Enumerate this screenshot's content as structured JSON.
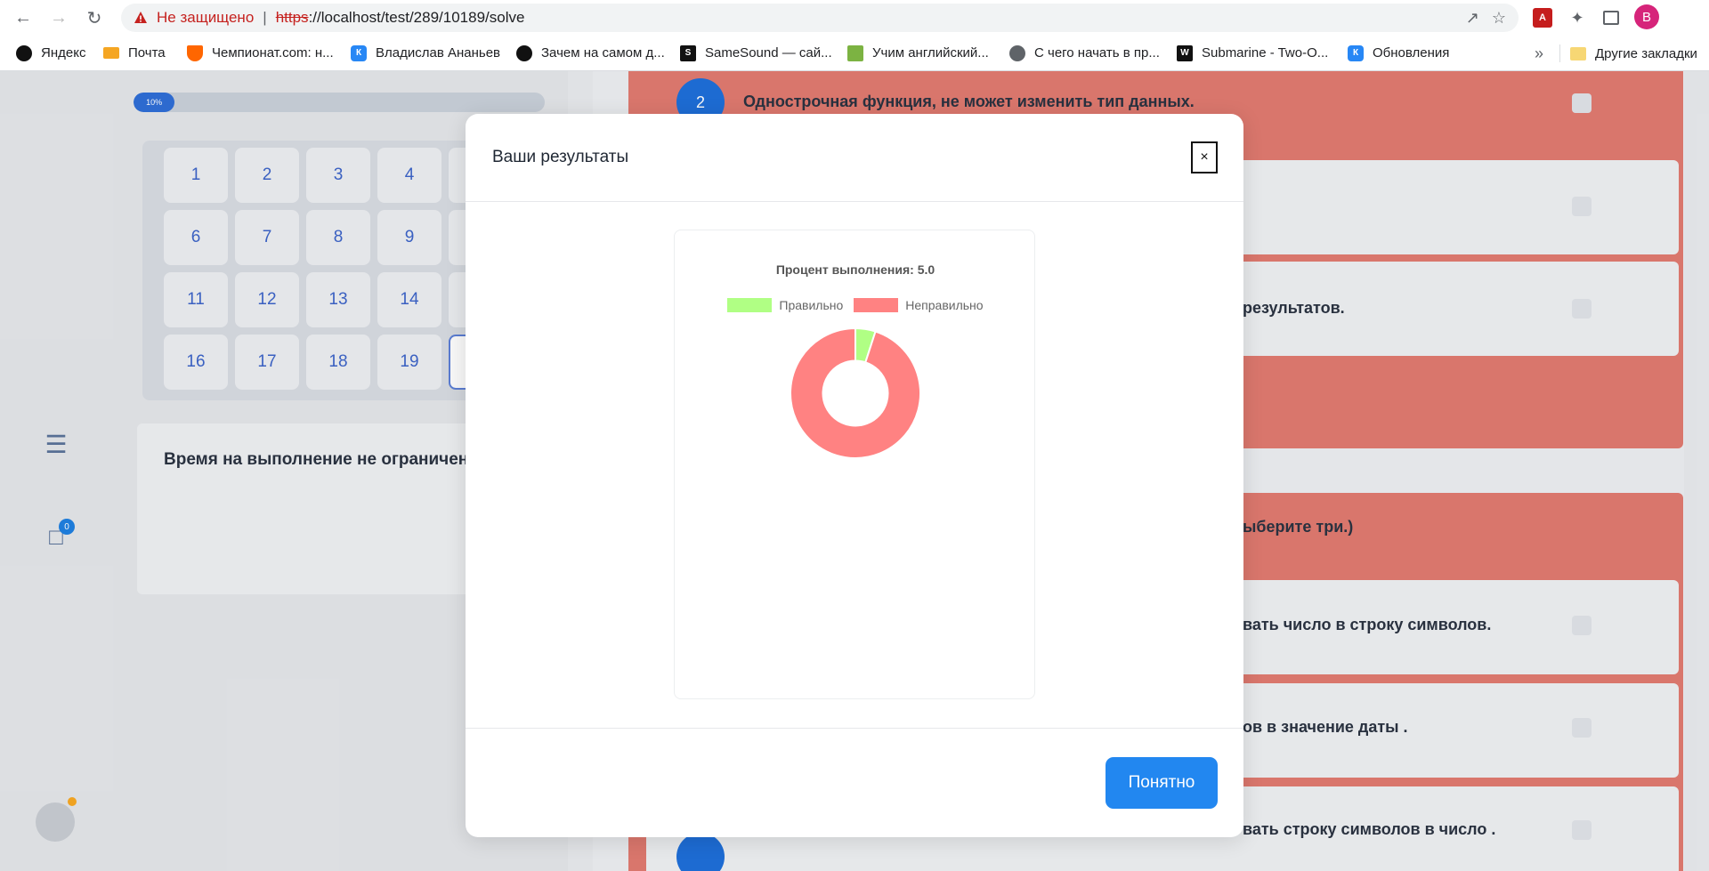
{
  "browser": {
    "security_label": "Не защищено",
    "url_scheme": "https",
    "url_rest": "://localhost/test/289/10189/solve",
    "profile_initial": "В",
    "bookmarks": [
      {
        "label": "Яндекс",
        "icon": "yandex-icon"
      },
      {
        "label": "Почта",
        "icon": "mail-icon"
      },
      {
        "label": "Чемпионат.com: н...",
        "icon": "championat-icon"
      },
      {
        "label": "Владислав Ананьев",
        "icon": "vk-icon"
      },
      {
        "label": "Зачем на самом д...",
        "icon": "yandex-icon"
      },
      {
        "label": "SameSound — сай...",
        "icon": "samesound-icon"
      },
      {
        "label": "Учим английский...",
        "icon": "puzzle-icon"
      },
      {
        "label": "С чего начать в пр...",
        "icon": "globe-icon"
      },
      {
        "label": "Submarine - Two-O...",
        "icon": "waves-icon"
      },
      {
        "label": "Обновления",
        "icon": "vk-icon"
      }
    ],
    "more_bookmarks": "»",
    "other_bookmarks": "Другие закладки"
  },
  "sidebar": {
    "chat_badge": "0"
  },
  "progress": {
    "label": "10%",
    "value_percent": 10
  },
  "question_grid": {
    "numbers": [
      "1",
      "2",
      "3",
      "4",
      "6",
      "7",
      "8",
      "9",
      "11",
      "12",
      "13",
      "14",
      "16",
      "17",
      "18",
      "19"
    ]
  },
  "timer": {
    "text": "Время на выполнение не ограничено"
  },
  "questions": {
    "q2_number": "2",
    "q2_text": "Однострочная функция, не может изменить тип данных.",
    "row_results": "результатов.",
    "prompt_tail": "ыберите три.)",
    "ans1": "вать число в строку символов.",
    "ans2": "ов в значение даты .",
    "ans3": "вать строку символов в число ."
  },
  "modal": {
    "title": "Ваши результаты",
    "close_label": "×",
    "confirm_label": "Понятно"
  },
  "chart_data": {
    "type": "pie",
    "title": "Процент выполнения: 5.0",
    "legend_position": "top",
    "series": [
      {
        "name": "Правильно",
        "value": 5,
        "color": "#b0ff84"
      },
      {
        "name": "Неправильно",
        "value": 95,
        "color": "#ff8282"
      }
    ],
    "hole": 0.5
  },
  "colors": {
    "accent": "#2287f0",
    "wrong_block": "#e07a70"
  }
}
